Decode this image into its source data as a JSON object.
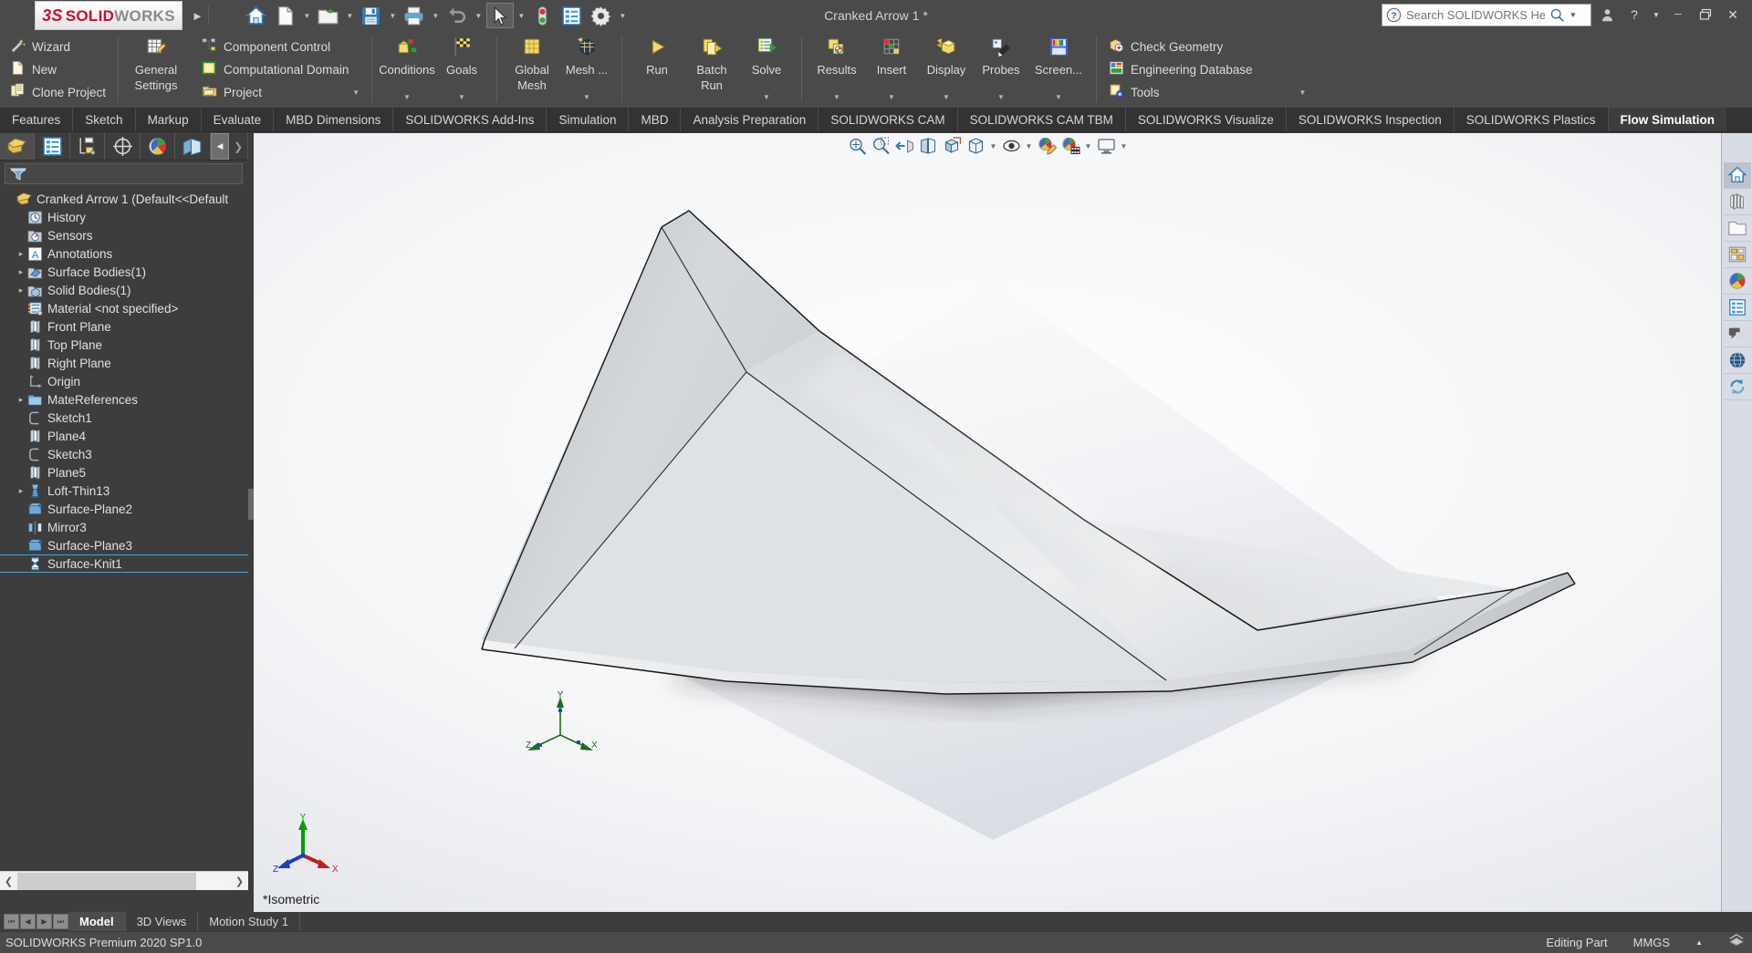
{
  "titlebar": {
    "logo_ds": "3S",
    "logo_solid": "SOLID",
    "logo_works": "WORKS",
    "document_title": "Cranked Arrow 1 *",
    "help_placeholder": "Search SOLIDWORKS Help",
    "tools": [
      {
        "name": "home-icon",
        "label": "Home"
      },
      {
        "name": "new-document-icon",
        "label": "New"
      },
      {
        "name": "open-folder-icon",
        "label": "Open"
      },
      {
        "name": "save-icon",
        "label": "Save"
      },
      {
        "name": "print-icon",
        "label": "Print"
      },
      {
        "name": "undo-icon",
        "label": "Undo"
      },
      {
        "name": "select-cursor-icon",
        "label": "Select"
      },
      {
        "name": "rebuild-icon",
        "label": "Rebuild"
      },
      {
        "name": "options-list-icon",
        "label": "File Properties"
      },
      {
        "name": "gear-icon",
        "label": "Options"
      }
    ],
    "window_controls": [
      {
        "name": "user-account-icon",
        "glyph": "♟"
      },
      {
        "name": "help-question-icon",
        "glyph": "?"
      },
      {
        "name": "minimize-icon",
        "glyph": "—"
      },
      {
        "name": "restore-icon",
        "glyph": "❐"
      },
      {
        "name": "close-icon",
        "glyph": "✕"
      }
    ]
  },
  "ribbon": {
    "groups": [
      {
        "name": "project-group",
        "items": [
          {
            "label": "Wizard",
            "icon": "wizard-icon"
          },
          {
            "label": "New",
            "icon": "new-icon"
          },
          {
            "label": "Clone Project",
            "icon": "clone-project-icon"
          }
        ]
      },
      {
        "name": "general-settings-group",
        "big": [
          {
            "label": "General\nSettings",
            "label1": "General",
            "label2": "Settings",
            "icon": "general-settings-icon"
          }
        ]
      },
      {
        "name": "domain-group",
        "items": [
          {
            "label": "Component Control",
            "icon": "component-control-icon"
          },
          {
            "label": "Computational Domain",
            "icon": "computational-domain-icon"
          },
          {
            "label": "Project",
            "icon": "project-icon",
            "dropdown": true
          }
        ]
      },
      {
        "name": "conditions-group",
        "big": [
          {
            "label": "Conditions",
            "icon": "conditions-icon",
            "dropdown": true
          },
          {
            "label": "Goals",
            "icon": "goals-icon",
            "dropdown": true
          }
        ]
      },
      {
        "name": "mesh-group",
        "big": [
          {
            "label1": "Global",
            "label2": "Mesh",
            "icon": "global-mesh-icon"
          },
          {
            "label1": "Mesh ...",
            "label2": "",
            "icon": "mesh-icon",
            "dropdown": true
          }
        ]
      },
      {
        "name": "solve-group",
        "big": [
          {
            "label1": "Run",
            "label2": "",
            "icon": "run-icon"
          },
          {
            "label1": "Batch",
            "label2": "Run",
            "icon": "batch-run-icon"
          },
          {
            "label1": "Solve",
            "label2": "",
            "icon": "solve-icon",
            "dropdown": true
          }
        ]
      },
      {
        "name": "results-group",
        "big": [
          {
            "label1": "Results",
            "label2": "",
            "icon": "results-icon",
            "dropdown": true
          },
          {
            "label1": "Insert",
            "label2": "",
            "icon": "insert-icon",
            "dropdown": true
          },
          {
            "label1": "Display",
            "label2": "",
            "icon": "display-icon",
            "dropdown": true
          },
          {
            "label1": "Probes",
            "label2": "",
            "icon": "probes-icon",
            "dropdown": true
          },
          {
            "label1": "Screen...",
            "label2": "",
            "icon": "screenshot-icon",
            "dropdown": true
          }
        ]
      },
      {
        "name": "tools-group",
        "items": [
          {
            "label": "Check Geometry",
            "icon": "check-geometry-icon"
          },
          {
            "label": "Engineering Database",
            "icon": "engineering-database-icon"
          },
          {
            "label": "Tools",
            "icon": "tools-icon",
            "dropdown": true
          }
        ]
      }
    ]
  },
  "command_tabs": [
    {
      "label": "Features",
      "active": false
    },
    {
      "label": "Sketch",
      "active": false
    },
    {
      "label": "Markup",
      "active": false
    },
    {
      "label": "Evaluate",
      "active": false
    },
    {
      "label": "MBD Dimensions",
      "active": false
    },
    {
      "label": "SOLIDWORKS Add-Ins",
      "active": false
    },
    {
      "label": "Simulation",
      "active": false
    },
    {
      "label": "MBD",
      "active": false
    },
    {
      "label": "Analysis Preparation",
      "active": false
    },
    {
      "label": "SOLIDWORKS CAM",
      "active": false
    },
    {
      "label": "SOLIDWORKS CAM TBM",
      "active": false
    },
    {
      "label": "SOLIDWORKS Visualize",
      "active": false
    },
    {
      "label": "SOLIDWORKS Inspection",
      "active": false
    },
    {
      "label": "SOLIDWORKS Plastics",
      "active": false
    },
    {
      "label": "Flow Simulation",
      "active": true
    }
  ],
  "feature_manager": {
    "tabs": [
      {
        "name": "feature-tree-tab",
        "icon": "feature-tree-icon",
        "active": true
      },
      {
        "name": "property-manager-tab",
        "icon": "property-manager-icon",
        "active": false
      },
      {
        "name": "configuration-manager-tab",
        "icon": "configuration-manager-icon",
        "active": false
      },
      {
        "name": "dimxpert-manager-tab",
        "icon": "dimxpert-icon",
        "active": false
      },
      {
        "name": "display-manager-tab",
        "icon": "display-manager-icon",
        "active": false
      },
      {
        "name": "flow-simulation-tab",
        "icon": "flow-simulation-tree-icon",
        "active": false
      },
      {
        "name": "collapse-panel-button",
        "icon": "chevron-left-icon",
        "active": false
      },
      {
        "name": "expand-panel-button",
        "icon": "chevron-right-icon",
        "active": false
      }
    ],
    "filter_placeholder": "",
    "tree": [
      {
        "label": "Cranked Arrow 1  (Default<<Default",
        "icon": "part-icon",
        "indent": 0,
        "expand": "",
        "selected": false
      },
      {
        "label": "History",
        "icon": "history-icon",
        "indent": 1,
        "expand": "",
        "selected": false
      },
      {
        "label": "Sensors",
        "icon": "sensors-icon",
        "indent": 1,
        "expand": "",
        "selected": false
      },
      {
        "label": "Annotations",
        "icon": "annotations-icon",
        "indent": 1,
        "expand": "▸",
        "selected": false
      },
      {
        "label": "Surface Bodies(1)",
        "icon": "surface-bodies-icon",
        "indent": 1,
        "expand": "▸",
        "selected": false
      },
      {
        "label": "Solid Bodies(1)",
        "icon": "solid-bodies-icon",
        "indent": 1,
        "expand": "▸",
        "selected": false
      },
      {
        "label": "Material <not specified>",
        "icon": "material-icon",
        "indent": 1,
        "expand": "",
        "selected": false
      },
      {
        "label": "Front Plane",
        "icon": "plane-icon",
        "indent": 1,
        "expand": "",
        "selected": false
      },
      {
        "label": "Top Plane",
        "icon": "plane-icon",
        "indent": 1,
        "expand": "",
        "selected": false
      },
      {
        "label": "Right Plane",
        "icon": "plane-icon",
        "indent": 1,
        "expand": "",
        "selected": false
      },
      {
        "label": "Origin",
        "icon": "origin-icon",
        "indent": 1,
        "expand": "",
        "selected": false
      },
      {
        "label": "MateReferences",
        "icon": "folder-icon",
        "indent": 1,
        "expand": "▸",
        "selected": false
      },
      {
        "label": "Sketch1",
        "icon": "sketch-icon",
        "indent": 1,
        "expand": "",
        "selected": false
      },
      {
        "label": "Plane4",
        "icon": "plane-icon",
        "indent": 1,
        "expand": "",
        "selected": false
      },
      {
        "label": "Sketch3",
        "icon": "sketch-icon",
        "indent": 1,
        "expand": "",
        "selected": false
      },
      {
        "label": "Plane5",
        "icon": "plane-icon",
        "indent": 1,
        "expand": "",
        "selected": false
      },
      {
        "label": "Loft-Thin13",
        "icon": "loft-thin-icon",
        "indent": 1,
        "expand": "▸",
        "selected": false
      },
      {
        "label": "Surface-Plane2",
        "icon": "surface-plane-icon",
        "indent": 1,
        "expand": "",
        "selected": false
      },
      {
        "label": "Mirror3",
        "icon": "mirror-icon",
        "indent": 1,
        "expand": "",
        "selected": false
      },
      {
        "label": "Surface-Plane3",
        "icon": "surface-plane-icon",
        "indent": 1,
        "expand": "",
        "selected": false
      },
      {
        "label": "Surface-Knit1",
        "icon": "surface-knit-icon",
        "indent": 1,
        "expand": "",
        "selected": true
      }
    ]
  },
  "viewport": {
    "view_label": "*Isometric",
    "hud_buttons": [
      {
        "name": "zoom-to-fit-icon",
        "dropdown": false
      },
      {
        "name": "zoom-to-area-icon",
        "dropdown": false
      },
      {
        "name": "previous-view-icon",
        "dropdown": false
      },
      {
        "name": "section-view-icon",
        "dropdown": false
      },
      {
        "name": "view-orientation-icon",
        "dropdown": false
      },
      {
        "name": "display-style-icon",
        "dropdown": true
      },
      {
        "name": "hide-show-items-icon",
        "dropdown": true
      },
      {
        "name": "edit-appearance-icon",
        "dropdown": false
      },
      {
        "name": "apply-scene-icon",
        "dropdown": true
      },
      {
        "name": "view-settings-icon",
        "dropdown": true
      }
    ],
    "triad_axes": [
      {
        "label": "Y",
        "color": "#00a000"
      },
      {
        "label": "X",
        "color": "#cc2222"
      },
      {
        "label": "Z",
        "color": "#2222cc"
      }
    ],
    "origin_triad_axes": [
      {
        "label": "Y",
        "color": "#1f6b1f"
      },
      {
        "label": "X",
        "color": "#1f6b1f"
      },
      {
        "label": "Z",
        "color": "#1f6b1f"
      }
    ]
  },
  "task_pane": [
    {
      "name": "task-pane-home-icon",
      "active": true
    },
    {
      "name": "design-library-icon",
      "active": false
    },
    {
      "name": "file-explorer-icon",
      "active": false
    },
    {
      "name": "view-palette-icon",
      "active": false
    },
    {
      "name": "appearances-scenes-icon",
      "active": false
    },
    {
      "name": "custom-properties-icon",
      "active": false
    },
    {
      "name": "solidworks-forum-icon",
      "active": false
    },
    {
      "name": "3dexperience-marketplace-icon",
      "active": false
    },
    {
      "name": "sync-icon",
      "active": false
    }
  ],
  "bottom": {
    "nav_buttons": [
      {
        "name": "first-tab-button",
        "glyph": "⏮"
      },
      {
        "name": "previous-tab-button",
        "glyph": "◀"
      },
      {
        "name": "next-tab-button",
        "glyph": "▶"
      },
      {
        "name": "last-tab-button",
        "glyph": "⏭"
      }
    ],
    "doc_tabs": [
      {
        "label": "Model",
        "active": true
      },
      {
        "label": "3D Views",
        "active": false
      },
      {
        "label": "Motion Study 1",
        "active": false
      }
    ]
  },
  "status_bar": {
    "left": "SOLIDWORKS Premium 2020 SP1.0",
    "editing_state": "Editing Part",
    "units": "MMGS",
    "units_arrow": "▲",
    "overlay_icon": "sheet-scale-icon"
  }
}
